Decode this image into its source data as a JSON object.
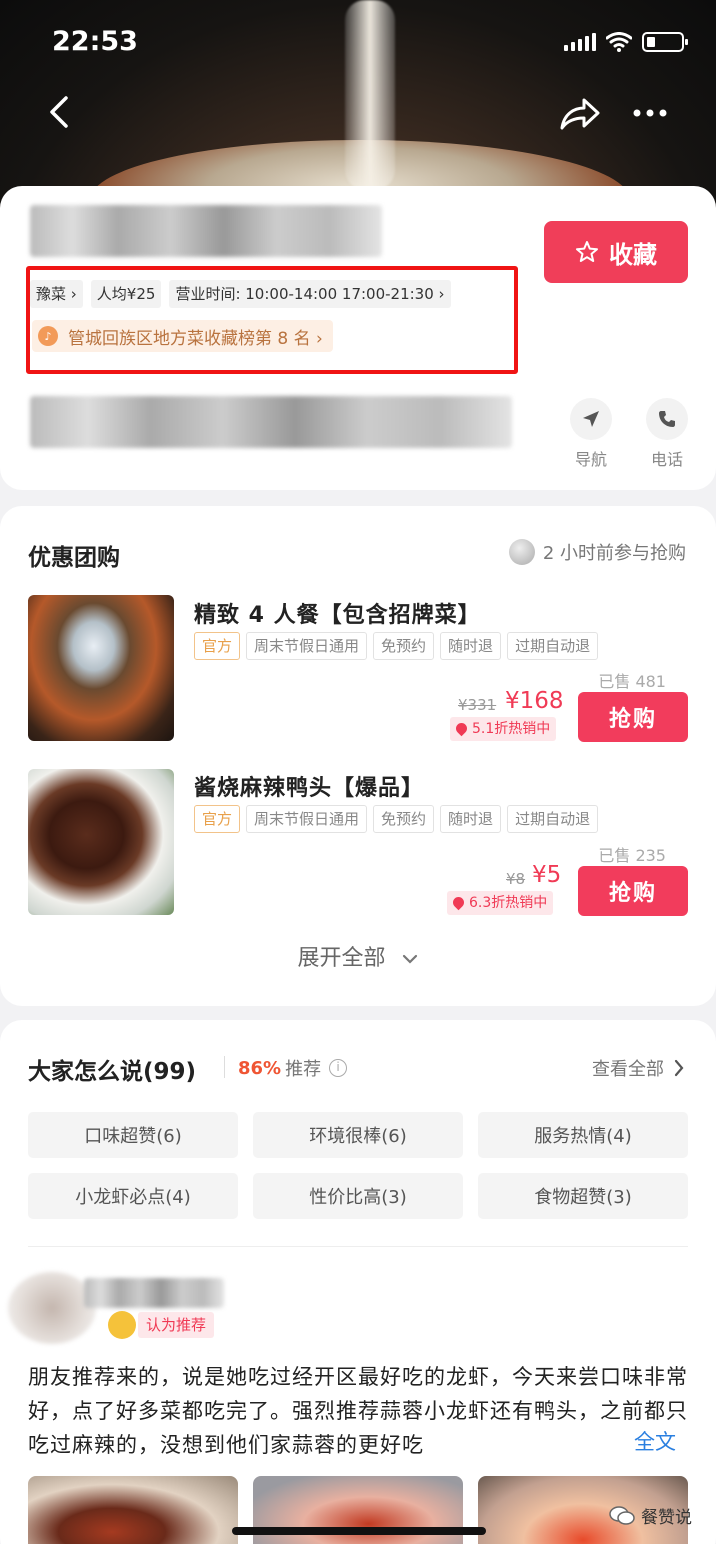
{
  "status_bar": {
    "time": "22:53"
  },
  "shop": {
    "favorite_label": "收藏",
    "cuisine": "豫菜",
    "avg_price": "人均¥25",
    "hours": "营业时间: 10:00-14:00 17:00-21:30",
    "rank": "管城回族区地方菜收藏榜第 8 名",
    "nav_label": "导航",
    "phone_label": "电话"
  },
  "deals_section": {
    "title": "优惠团购",
    "recent_activity": "2 小时前参与抢购",
    "items": [
      {
        "title": "精致 4 人餐【包含招牌菜】",
        "tags": [
          "官方",
          "周末节假日通用",
          "免预约",
          "随时退",
          "过期自动退"
        ],
        "sold": "已售 481",
        "original_price": "¥331",
        "price": "¥168",
        "discount": "5.1折热销中",
        "buy_label": "抢购"
      },
      {
        "title": "酱烧麻辣鸭头【爆品】",
        "tags": [
          "官方",
          "周末节假日通用",
          "免预约",
          "随时退",
          "过期自动退"
        ],
        "sold": "已售 235",
        "original_price": "¥8",
        "price": "¥5",
        "discount": "6.3折热销中",
        "buy_label": "抢购"
      }
    ],
    "expand_label": "展开全部"
  },
  "reviews_section": {
    "title": "大家怎么说(99)",
    "recommend_pct": "86%",
    "recommend_label": "推荐",
    "view_all": "查看全部",
    "tags": [
      "口味超赞(6)",
      "环境很棒(6)",
      "服务热情(4)",
      "小龙虾必点(4)",
      "性价比高(3)",
      "食物超赞(3)"
    ],
    "review": {
      "badge": "认为推荐",
      "text": "朋友推荐来的，说是她吃过经开区最好吃的龙虾，今天来尝口味非常好，点了好多菜都吃完了。强烈推荐蒜蓉小龙虾还有鸭头，之前都只吃过麻辣的，没想到他们家蒜蓉的更好吃",
      "full_text_label": "全文"
    }
  },
  "watermark": "餐赞说",
  "colors": {
    "accent": "#f03e59",
    "rank_text": "#b9733f",
    "link": "#2a7fe0"
  }
}
